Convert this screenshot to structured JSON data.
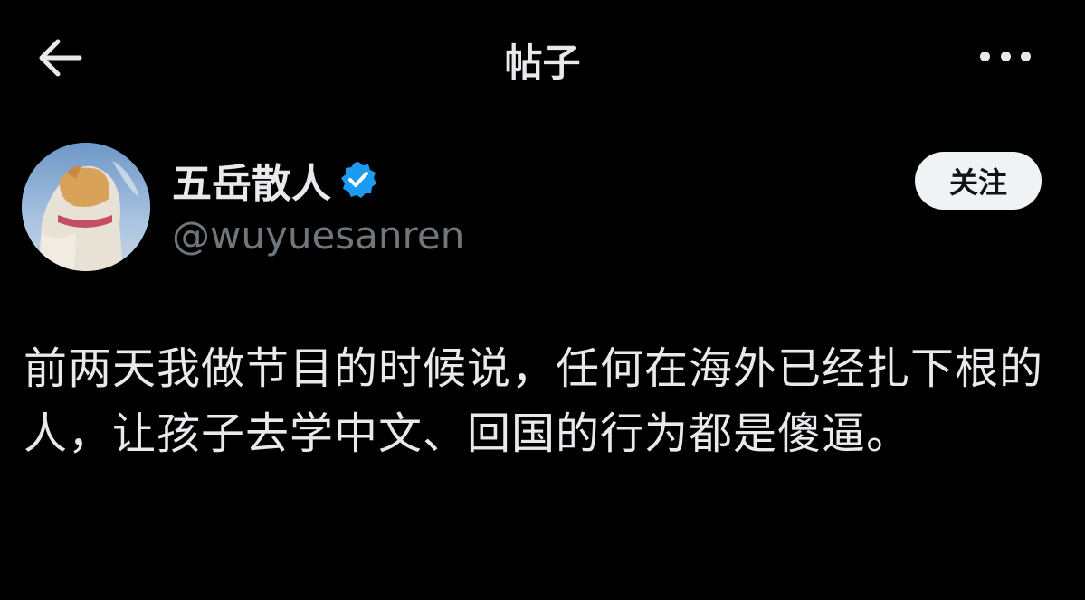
{
  "header": {
    "title": "帖子",
    "back_icon": "arrow-left-icon",
    "more_icon": "more-horizontal-icon"
  },
  "author": {
    "display_name": "五岳散人",
    "handle": "@wuyuesanren",
    "verified": true,
    "verified_color": "#1d9bf0",
    "avatar": "cat-avatar"
  },
  "actions": {
    "follow_label": "关注"
  },
  "post": {
    "text": "前两天我做节目的时候说，任何在海外已经扎下根的人，让孩子去学中文、回国的行为都是傻逼。"
  },
  "colors": {
    "background": "#000000",
    "primary_text": "#e7e9ea",
    "secondary_text": "#71767b",
    "follow_button_bg": "#eff3f4"
  }
}
